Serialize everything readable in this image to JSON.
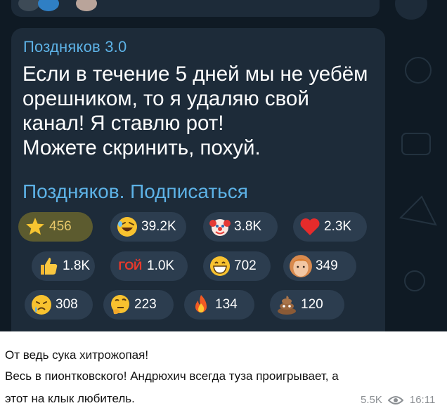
{
  "post": {
    "sender": "Поздняков 3.0",
    "message": "Если в течение 5 дней мы не уебём\nорешником, то я удаляю свой\nканал! Я ставлю рот!\nМожете скринить, похуй.",
    "link": "Поздняков. Подписаться"
  },
  "reactions": [
    {
      "emoji": "star-icon",
      "count": "456",
      "active": true
    },
    {
      "emoji": "rofl-icon",
      "count": "39.2K"
    },
    {
      "emoji": "clown-icon",
      "count": "3.8K"
    },
    {
      "emoji": "heart-icon",
      "count": "2.3K"
    },
    {
      "emoji": "thumbs-up-icon",
      "count": "1.8K"
    },
    {
      "emoji": "goi-icon",
      "label": "ГОЙ",
      "count": "1.0K"
    },
    {
      "emoji": "grin-icon",
      "count": "702"
    },
    {
      "emoji": "face-photo-icon",
      "count": "349"
    },
    {
      "emoji": "crying-icon",
      "count": "308"
    },
    {
      "emoji": "thinking-icon",
      "count": "223"
    },
    {
      "emoji": "fire-icon",
      "count": "134"
    },
    {
      "emoji": "poop-icon",
      "count": "120"
    }
  ],
  "caption": {
    "line1": "От ведь сука хитрожопая!",
    "line2": "Весь в пионтковского! Андрюхич всегда туза проигрывает, а",
    "line3": "этот на клык любитель."
  },
  "meta": {
    "views": "5.5K",
    "time": "16:11"
  },
  "colors": {
    "chat_bg": "#0f1a24",
    "bubble": "#1d2b39",
    "accent": "#5db2e6",
    "reaction_bg": "#2c3d4f",
    "reaction_active": "#5c5b2f"
  }
}
